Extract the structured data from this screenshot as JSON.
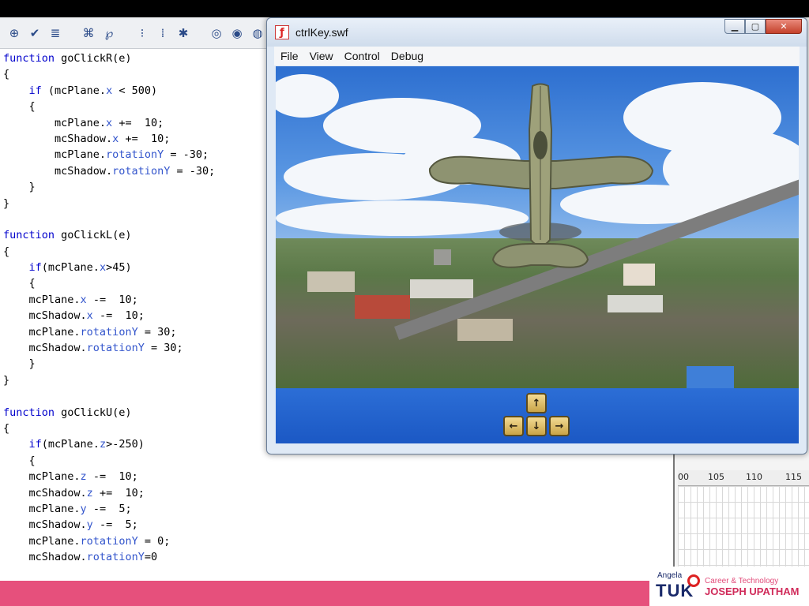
{
  "player": {
    "title": "ctrlKey.swf",
    "menu": [
      "File",
      "View",
      "Control",
      "Debug"
    ],
    "minimize_icon": "minimize-icon",
    "maximize_icon": "maximize-icon",
    "close_icon": "close-icon"
  },
  "editor": {
    "toolbar_icons": [
      "crosshair-icon",
      "check-icon",
      "align-icon",
      "comment-icon",
      "wrap-icon",
      "collapse-icon",
      "expand-icon",
      "star-icon",
      "balloon-icon",
      "balloon2-icon",
      "balloon3-icon",
      "panel-icon"
    ],
    "code_lines": [
      "function goClickR(e)",
      "{",
      "    if (mcPlane.x < 500)",
      "    {",
      "        mcPlane.x +=  10;",
      "        mcShadow.x +=  10;",
      "        mcPlane.rotationY = -30;",
      "        mcShadow.rotationY = -30;",
      "    }",
      "}",
      "",
      "function goClickL(e)",
      "{",
      "    if(mcPlane.x>45)",
      "    {",
      "    mcPlane.x -=  10;",
      "    mcShadow.x -=  10;",
      "    mcPlane.rotationY = 30;",
      "    mcShadow.rotationY = 30;",
      "    }",
      "}",
      "",
      "function goClickU(e)",
      "{",
      "    if(mcPlane.z>-250)",
      "    {",
      "    mcPlane.z -=  10;",
      "    mcShadow.z +=  10;",
      "    mcPlane.y -=  5;",
      "    mcShadow.y -=  5;",
      "    mcPlane.rotationY = 0;",
      "    mcShadow.rotationY=0"
    ]
  },
  "timeline": {
    "ruler_labels": [
      "00",
      "105",
      "110",
      "115"
    ]
  },
  "stage": {
    "keys": {
      "up": "↑",
      "left": "←",
      "down": "↓",
      "right": "→"
    }
  },
  "footer": {
    "logo_small": "Angela",
    "logo_main": "TUK",
    "logo_sub": "Career & Technology",
    "logo_name": "JOSEPH UPATHAM"
  },
  "colors": {
    "footer_pink": "#e6507c",
    "control_blue": "#1b58c4",
    "keyword_blue": "#0000cc"
  }
}
